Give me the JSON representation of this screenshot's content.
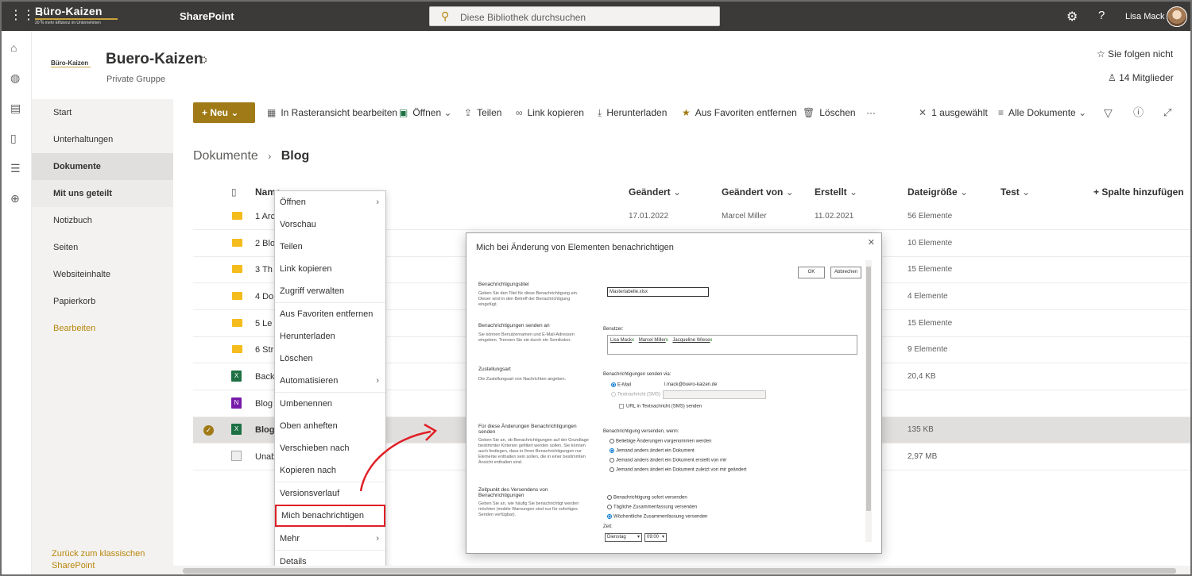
{
  "topbar": {
    "brand": "Büro-Kaizen",
    "brand_tagline": "20 % mehr Effizienz im Unternehmen",
    "app": "SharePoint",
    "search_placeholder": "Diese Bibliothek durchsuchen",
    "user": "Lisa Mack"
  },
  "site": {
    "logo_text": "Büro-Kaizen",
    "title": "Buero-Kaizen",
    "subtitle": "Private Gruppe",
    "follow": "Sie folgen nicht",
    "members": "14 Mitglieder"
  },
  "nav": {
    "items": [
      "Start",
      "Unterhaltungen",
      "Dokumente",
      "Mit uns geteilt",
      "Notizbuch",
      "Seiten",
      "Websiteinhalte",
      "Papierkorb",
      "Bearbeiten"
    ],
    "classic": "Zurück zum klassischen SharePoint"
  },
  "commands": {
    "new": "Neu",
    "grid": "In Rasteransicht bearbeiten",
    "open": "Öffnen",
    "share": "Teilen",
    "copy_link": "Link kopieren",
    "download": "Herunterladen",
    "unfav": "Aus Favoriten entfernen",
    "delete": "Löschen",
    "more": "···",
    "selected": "1 ausgewählt",
    "view": "Alle Dokumente"
  },
  "breadcrumb": {
    "parent": "Dokumente",
    "current": "Blog"
  },
  "table": {
    "headers": {
      "name": "Name",
      "modified": "Geändert",
      "modified_by": "Geändert von",
      "created": "Erstellt",
      "size": "Dateigröße",
      "test": "Test",
      "add": "+ Spalte hinzufügen"
    },
    "rows": [
      {
        "name": "1 Arc",
        "modified": "17.01.2022",
        "by": "Marcel Miller",
        "created": "11.02.2021",
        "size": "56 Elemente"
      },
      {
        "name": "2 Blo",
        "modified": "",
        "by": "",
        "created": "",
        "size": "10 Elemente"
      },
      {
        "name": "3 Th",
        "modified": "",
        "by": "",
        "created": "",
        "size": "15 Elemente"
      },
      {
        "name": "4 Do",
        "modified": "",
        "by": "",
        "created": "",
        "size": "4 Elemente"
      },
      {
        "name": "5 Le",
        "modified": "",
        "by": "",
        "created": "",
        "size": "15 Elemente"
      },
      {
        "name": "6 Str",
        "modified": "",
        "by": "",
        "created": "",
        "size": "9 Elemente"
      },
      {
        "name": "Back",
        "modified": "",
        "by": "",
        "created": "",
        "size": "20,4 KB"
      },
      {
        "name": "Blog",
        "modified": "",
        "by": "",
        "created": "",
        "size": ""
      },
      {
        "name": "Blog",
        "modified": "",
        "by": "",
        "created": "",
        "size": "135 KB"
      },
      {
        "name": "Unab",
        "modified": "",
        "by": "",
        "created": "",
        "size": "2,97 MB"
      }
    ]
  },
  "context_menu": [
    "Öffnen",
    "Vorschau",
    "Teilen",
    "Link kopieren",
    "Zugriff verwalten",
    "Aus Favoriten entfernen",
    "Herunterladen",
    "Löschen",
    "Automatisieren",
    "Umbenennen",
    "Oben anheften",
    "Verschieben nach",
    "Kopieren nach",
    "Versionsverlauf",
    "Mich benachrichtigen",
    "Mehr",
    "Details"
  ],
  "dialog": {
    "title": "Mich bei Änderung von Elementen benachrichtigen",
    "ok": "OK",
    "cancel": "Abbrechen",
    "s1_title": "Benachrichtigungstitel",
    "s1_desc": "Geben Sie den Titel für diese Benachrichtigung ein. Dieser wird in den Betreff der Benachrichtigung eingefügt.",
    "s1_value": "Mastertabelle.xlsx",
    "s2_title": "Benachrichtigungen senden an",
    "s2_desc": "Sie können Benutzernamen und E-Mail-Adressen eingeben. Trennen Sie sie durch ein Semikolon.",
    "users_label": "Benutzer:",
    "users": [
      "Lisa Mack",
      "Marcel Miller",
      "Jacqueline Wiese"
    ],
    "s3_title": "Zustellungsart",
    "s3_desc": "Die Zustellungsart von Nachrichten angeben.",
    "via_label": "Benachrichtigungen senden via:",
    "email": "E-Mail",
    "email_addr": "l.mack@buero-kaizen.de",
    "sms": "Textnachricht (SMS)",
    "sms_url": "URL in Textnachricht (SMS) senden",
    "s4_title": "Für diese Änderungen Benachrichtigungen senden",
    "s4_desc": "Geben Sie an, ob Benachrichtigungen auf der Grundlage bestimmter Kriterien gefiltert werden sollen. Sie können auch festlegen, dass in Ihren Benachrichtigungen nur Elemente enthalten sein sollen, die in einer bestimmten Ansicht enthalten sind.",
    "when_label": "Benachrichtigung versenden, wenn:",
    "when_opts": [
      "Beliebige Änderungen vorgenommen werden",
      "Jemand anders ändert ein Dokument",
      "Jemand anders ändert ein Dokument erstellt von mir",
      "Jemand anders ändert ein Dokument zuletzt von mir geändert"
    ],
    "s5_title": "Zeitpunkt des Versendens von Benachrichtigungen",
    "s5_desc": "Geben Sie an, wie häufig Sie benachrichtigt werden möchten (mobile Warnungen sind nur für sofortiges Senden verfügbar).",
    "freq_opts": [
      "Benachrichtigung sofort versenden",
      "Tägliche Zusammenfassung versenden",
      "Wöchentliche Zusammenfassung versenden"
    ],
    "time_label": "Zeit:",
    "day": "Dienstag",
    "time": "09:00"
  }
}
